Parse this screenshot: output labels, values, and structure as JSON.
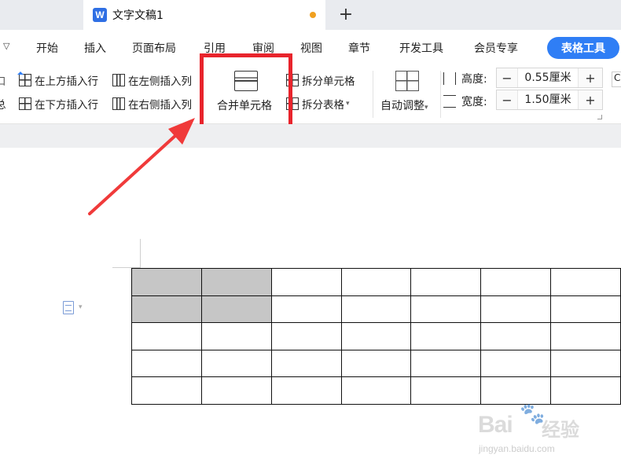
{
  "window": {
    "doc_tab_title": "文字文稿1",
    "doc_icon_letter": "W",
    "add_tab_glyph": "+",
    "accent_color": "#2f7ef5",
    "unsaved_dot_color": "#f0a020"
  },
  "menu": {
    "overflow_glyph": "▽",
    "items": [
      "开始",
      "插入",
      "页面布局",
      "引用",
      "审阅",
      "视图",
      "章节",
      "开发工具",
      "会员专享"
    ],
    "active_tab": "表格工具"
  },
  "ribbon": {
    "insert_row_above": "在上方插入行",
    "insert_row_below": "在下方插入行",
    "insert_col_left": "在左侧插入列",
    "insert_col_right": "在右侧插入列",
    "merge_cells": "合并单元格",
    "split_cells": "拆分单元格",
    "split_table": "拆分表格",
    "auto_fit": "自动调整",
    "height_label": "高度:",
    "height_value": "0.55厘米",
    "width_label": "宽度:",
    "width_value": "1.50厘米",
    "minus_glyph": "−",
    "plus_glyph": "+",
    "dropdown_glyph": "▾",
    "clipped_left_glyph_top": "口",
    "clipped_left_glyph_bottom": "总",
    "clipped_right_glyph": "C"
  },
  "annotation": {
    "highlight_color": "#e8242c",
    "arrow_color": "#f03a3a",
    "target": "merge-cells-button"
  },
  "table": {
    "rows": 5,
    "cols": 7,
    "selected_cells": [
      [
        0,
        0
      ],
      [
        0,
        1
      ],
      [
        1,
        0
      ],
      [
        1,
        1
      ]
    ],
    "selection_color": "#c6c6c6"
  },
  "watermark": {
    "brand": "Bai",
    "brand_tail": "经验",
    "url": "jingyan.baidu.com"
  }
}
